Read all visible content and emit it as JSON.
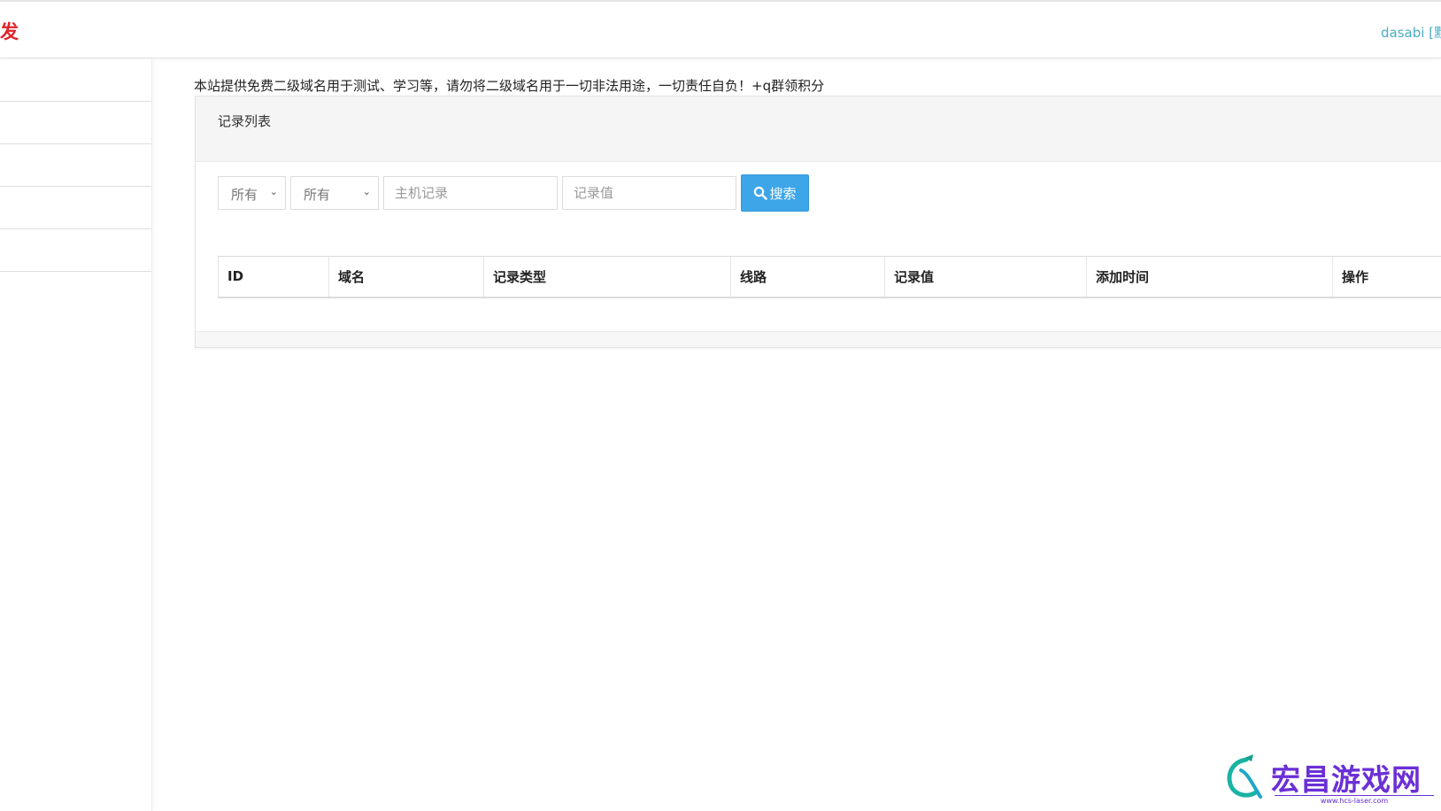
{
  "header": {
    "brand": "发",
    "user_link": "dasabi [默"
  },
  "sidebar": {
    "items": [
      "",
      "",
      "",
      "",
      ""
    ]
  },
  "main": {
    "notice": "本站提供免费二级域名用于测试、学习等，请勿将二级域名用于一切非法用途，一切责任自负！+q群领积分",
    "panel_title": "记录列表",
    "filters": {
      "select1_value": "所有",
      "select2_value": "所有",
      "host_placeholder": "主机记录",
      "value_placeholder": "记录值",
      "search_label": "搜索",
      "search_icon": "search-icon"
    },
    "table": {
      "columns": [
        "ID",
        "域名",
        "记录类型",
        "线路",
        "记录值",
        "添加时间",
        "操作"
      ],
      "rows": []
    }
  },
  "watermark": {
    "text": "宏昌游戏网",
    "url": "www.hcs-laser.com"
  },
  "colors": {
    "brand": "#e0232a",
    "link": "#4aaec2",
    "primary_button": "#3da6e8",
    "watermark": "#6b2fd6"
  }
}
